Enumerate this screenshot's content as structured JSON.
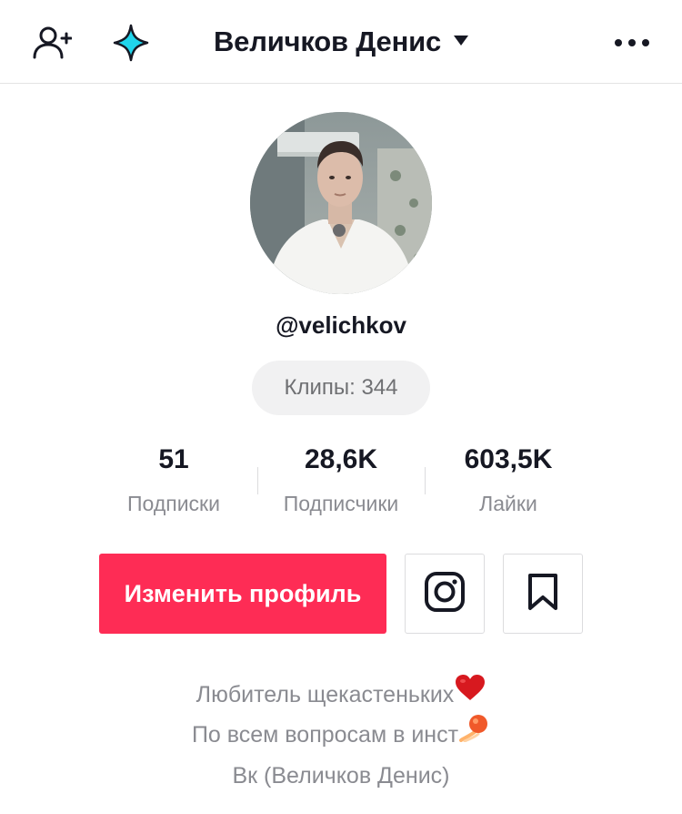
{
  "header": {
    "title": "Величков Денис",
    "icons": [
      "add-user-icon",
      "sparkle-icon",
      "caret-down-icon",
      "more-icon"
    ]
  },
  "profile": {
    "username": "@velichkov",
    "clips_label": "Клипы: 344"
  },
  "stats": [
    {
      "value": "51",
      "label": "Подписки"
    },
    {
      "value": "28,6K",
      "label": "Подписчики"
    },
    {
      "value": "603,5K",
      "label": "Лайки"
    }
  ],
  "actions": {
    "edit_profile": "Изменить профиль",
    "instagram_icon": "instagram-icon",
    "bookmark_icon": "bookmark-icon"
  },
  "bio": {
    "lines": [
      {
        "text": "Любитель щекастеньких",
        "emoji": "heart-icon"
      },
      {
        "text": "По всем вопросам в инст",
        "emoji": "comet-icon"
      },
      {
        "text": "Вк (Величков Денис)"
      }
    ]
  },
  "colors": {
    "accent": "#fe2c55",
    "text_primary": "#161823",
    "text_secondary": "#8a8b91",
    "sparkle": "#20d5ec"
  }
}
